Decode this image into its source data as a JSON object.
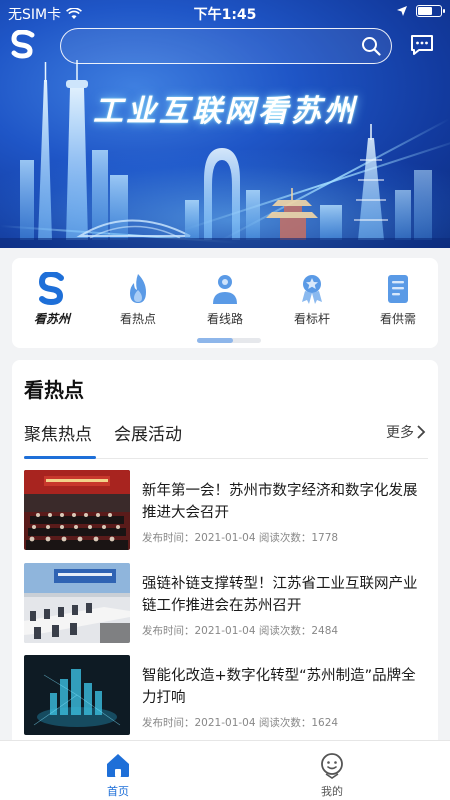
{
  "status_bar": {
    "carrier": "无SIM卡",
    "time": "下午1:45"
  },
  "header": {
    "search_placeholder": "",
    "banner_title": "工业互联网看苏州"
  },
  "categories": [
    {
      "label": "看苏州",
      "icon": "app-logo-icon",
      "active": true
    },
    {
      "label": "看热点",
      "icon": "flame-icon",
      "active": false
    },
    {
      "label": "看线路",
      "icon": "location-person-icon",
      "active": false
    },
    {
      "label": "看标杆",
      "icon": "award-medal-icon",
      "active": false
    },
    {
      "label": "看供需",
      "icon": "document-icon",
      "active": false
    }
  ],
  "hot": {
    "title": "看热点",
    "tabs": [
      "聚焦热点",
      "会展活动"
    ],
    "active_tab": 0,
    "more": "更多",
    "news": [
      {
        "title": "新年第一会！苏州市数字经济和数字化发展推进大会召开",
        "meta": "发布时间：2021-01-04 阅读次数：1778"
      },
      {
        "title": "强链补链支撑转型！江苏省工业互联网产业链工作推进会在苏州召开",
        "meta": "发布时间：2021-01-04 阅读次数：2484"
      },
      {
        "title": "智能化改造+数字化转型“苏州制造”品牌全力打响",
        "meta": "发布时间：2021-01-04 阅读次数：1624"
      }
    ]
  },
  "tabbar": {
    "home": "首页",
    "mine": "我的"
  },
  "colors": {
    "accent": "#1e6fd8",
    "banner_dark": "#0c2a7a",
    "banner_light": "#3f7fe0"
  }
}
